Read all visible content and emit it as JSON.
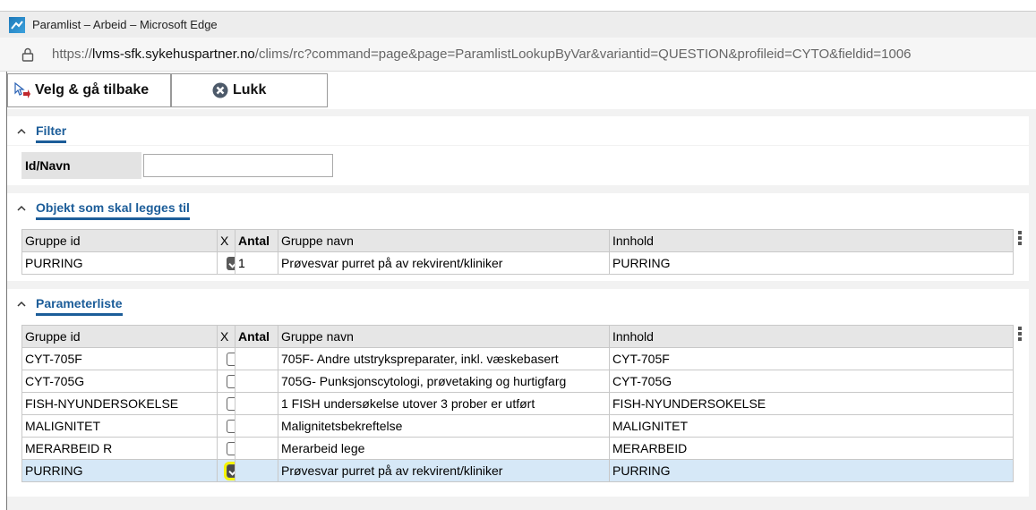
{
  "window": {
    "title": "Paramlist – Arbeid – Microsoft Edge",
    "url_prefix": "https://",
    "url_host": "lvms-sfk.sykehuspartner.no",
    "url_path": "/clims/rc?command=page&page=ParamlistLookupByVar&variantid=QUESTION&profileid=CYTO&fieldid=1006"
  },
  "toolbar": {
    "back_label": "Velg & gå tilbake",
    "close_label": "Lukk"
  },
  "filter": {
    "heading": "Filter",
    "label": "Id/Navn",
    "value": ""
  },
  "selected_section": {
    "heading": "Objekt som skal legges til",
    "columns": [
      "Gruppe id",
      "X",
      "Antal",
      "Gruppe navn",
      "Innhold"
    ],
    "rows": [
      {
        "id": "PURRING",
        "checked": true,
        "antal": "1",
        "navn": "Prøvesvar purret på av rekvirent/kliniker",
        "innhold": "PURRING"
      }
    ]
  },
  "param_section": {
    "heading": "Parameterliste",
    "columns": [
      "Gruppe id",
      "X",
      "Antal",
      "Gruppe navn",
      "Innhold"
    ],
    "rows": [
      {
        "id": "CYT-705F",
        "checked": false,
        "antal": "",
        "navn": "705F- Andre utstrykspreparater, inkl. væskebasert",
        "innhold": "CYT-705F"
      },
      {
        "id": "CYT-705G",
        "checked": false,
        "antal": "",
        "navn": "705G- Punksjonscytologi, prøvetaking og hurtigfarg",
        "innhold": "CYT-705G"
      },
      {
        "id": "FISH-NYUNDERSOKELSE",
        "checked": false,
        "antal": "",
        "navn": "1 FISH undersøkelse utover 3 prober er utført",
        "innhold": "FISH-NYUNDERSOKELSE"
      },
      {
        "id": "MALIGNITET",
        "checked": false,
        "antal": "",
        "navn": "Malignitetsbekreftelse",
        "innhold": "MALIGNITET"
      },
      {
        "id": "MERARBEID R",
        "checked": false,
        "antal": "",
        "navn": "Merarbeid lege",
        "innhold": "MERARBEID"
      },
      {
        "id": "PURRING",
        "checked": true,
        "antal": "",
        "navn": "Prøvesvar purret på av rekvirent/kliniker",
        "innhold": "PURRING",
        "selected": true
      }
    ]
  }
}
